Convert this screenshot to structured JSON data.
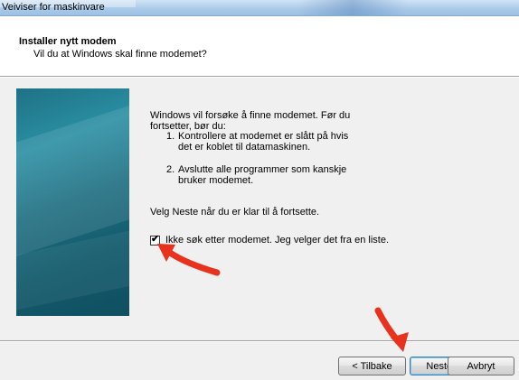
{
  "window": {
    "title": "Veiviser for maskinvare"
  },
  "header": {
    "title": "Installer nytt modem",
    "subtitle": "Vil du at Windows skal finne modemet?"
  },
  "body": {
    "intro_line1": "Windows vil forsøke å finne modemet. Før du",
    "intro_line2": "fortsetter, bør du:",
    "steps": [
      {
        "num": "1.",
        "line1": "Kontrollere at modemet er slått på hvis",
        "line2": "det er koblet til datamaskinen."
      },
      {
        "num": "2.",
        "line1": "Avslutte alle programmer som kanskje",
        "line2": "bruker modemet."
      }
    ],
    "instruction": "Velg Neste når du er klar til å fortsette.",
    "checkbox": {
      "label": "Ikke søk etter modemet. Jeg velger det fra en liste.",
      "checked": true,
      "mark": "✔"
    }
  },
  "buttons": {
    "back": "< Tilbake",
    "next": "Neste >",
    "cancel": "Avbryt"
  },
  "colors": {
    "annotation_arrow": "#e8321e",
    "side_graphic": "#1c6c7f"
  }
}
